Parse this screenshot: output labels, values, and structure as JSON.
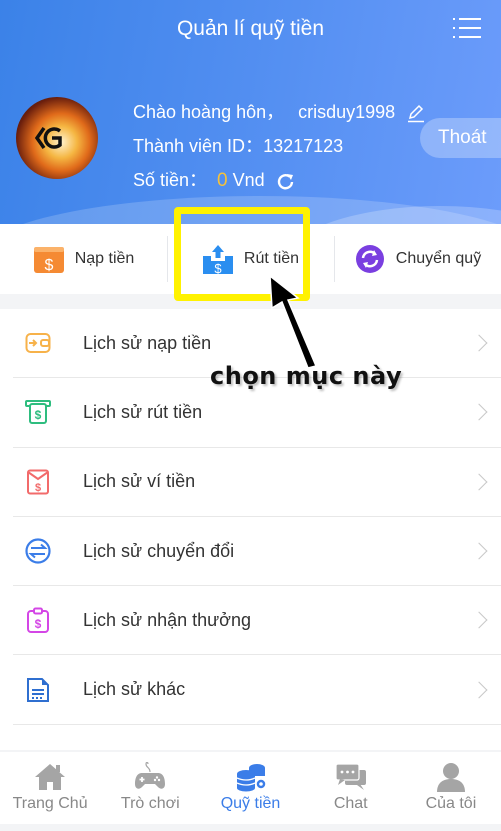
{
  "topbar": {
    "title": "Quản lí quỹ tiền",
    "menu_icon": "list-menu-icon"
  },
  "profile": {
    "greeting": "Chào hoàng hôn，",
    "username": "crisduy1998",
    "member_id_label": "Thành viên ID：",
    "member_id": "13217123",
    "balance_label": "Số tiền：",
    "balance": "0",
    "currency": "Vnd",
    "logout_label": "Thoát"
  },
  "quick_actions": [
    {
      "label": "Nạp tiền",
      "icon": "deposit-icon",
      "color": "#f57c2a"
    },
    {
      "label": "Rút tiền",
      "icon": "withdraw-icon",
      "color": "#2a8ef0"
    },
    {
      "label": "Chuyển quỹ",
      "icon": "transfer-icon",
      "color": "#7a3fe0"
    }
  ],
  "history": [
    {
      "label": "Lịch sử nạp tiền",
      "icon": "wallet-in-icon",
      "color": "#f7b24a"
    },
    {
      "label": "Lịch sử rút tiền",
      "icon": "atm-cash-icon",
      "color": "#2ebd7f"
    },
    {
      "label": "Lịch sử ví tiền",
      "icon": "envelope-money-icon",
      "color": "#f26b6b"
    },
    {
      "label": "Lịch sử chuyển đổi",
      "icon": "exchange-icon",
      "color": "#3b7de8"
    },
    {
      "label": "Lịch sử nhận thưởng",
      "icon": "clipboard-money-icon",
      "color": "#d446e6"
    },
    {
      "label": "Lịch sử khác",
      "icon": "document-icon",
      "color": "#2f6fd0"
    }
  ],
  "bottom_nav": [
    {
      "label": "Trang Chủ",
      "icon": "home-icon",
      "active": false
    },
    {
      "label": "Trò chơi",
      "icon": "gamepad-icon",
      "active": false
    },
    {
      "label": "Quỹ tiền",
      "icon": "coins-gear-icon",
      "active": true
    },
    {
      "label": "Chat",
      "icon": "chat-bubbles-icon",
      "active": false
    },
    {
      "label": "Của tôi",
      "icon": "user-icon",
      "active": false
    }
  ],
  "annotation": {
    "text": "chọn mục này",
    "highlight_color": "#fff200"
  },
  "colors": {
    "primary": "#3b7de8",
    "balance": "#f6c23a"
  }
}
